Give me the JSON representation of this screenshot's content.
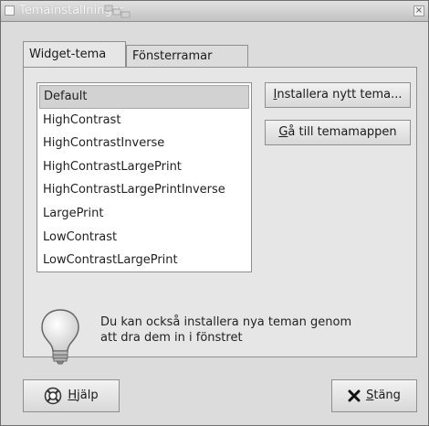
{
  "window": {
    "title": "Temainställningar",
    "close_glyph": "×",
    "icon": "window-menu-icon"
  },
  "tabs": [
    {
      "label": "Widget-tema",
      "active": true
    },
    {
      "label": "Fönsterramar",
      "active": false
    }
  ],
  "theme_list": {
    "items": [
      "Default",
      "HighContrast",
      "HighContrastInverse",
      "HighContrastLargePrint",
      "HighContrastLargePrintInverse",
      "LargePrint",
      "LowContrast",
      "LowContrastLargePrint"
    ],
    "selected": "Default"
  },
  "buttons": {
    "install_first": "I",
    "install_rest": "nstallera nytt tema...",
    "folder_first": "G",
    "folder_rest": "å till temamappen",
    "help_first": "H",
    "help_rest": "jälp",
    "close_first": "S",
    "close_rest": "täng"
  },
  "info": {
    "line1": "Du kan också installera nya teman genom",
    "line2": "att dra dem in i fönstret",
    "icon": "lightbulb-icon"
  },
  "icons": {
    "help": "help-lifebuoy-icon",
    "close": "close-x-icon"
  }
}
